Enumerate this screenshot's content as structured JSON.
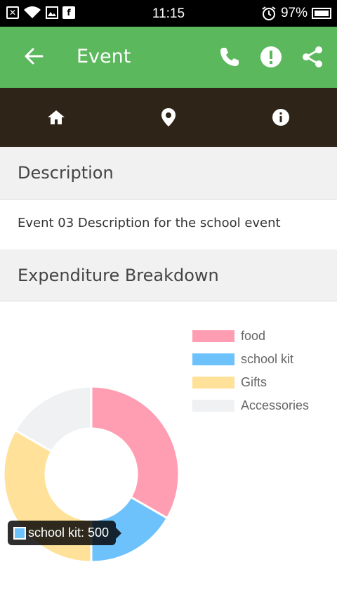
{
  "status_bar": {
    "time": "11:15",
    "battery": "97%"
  },
  "app_bar": {
    "title": "Event"
  },
  "tabs": [
    "home",
    "location",
    "info"
  ],
  "description": {
    "header": "Description",
    "text": "Event 03 Description for the school event"
  },
  "expenditure": {
    "header": "Expenditure Breakdown"
  },
  "colors": {
    "green": "#5cb85c",
    "dark": "#2f2418"
  },
  "chart_data": {
    "type": "pie",
    "categories": [
      "food",
      "school kit",
      "Gifts",
      "Accessories"
    ],
    "values": [
      1000,
      500,
      1000,
      500
    ],
    "colors": [
      "#ff9eb3",
      "#6ec2fc",
      "#ffe199",
      "#f0f1f3"
    ],
    "tooltip": {
      "label": "school kit",
      "value": "500",
      "text": "school kit: 500"
    }
  }
}
